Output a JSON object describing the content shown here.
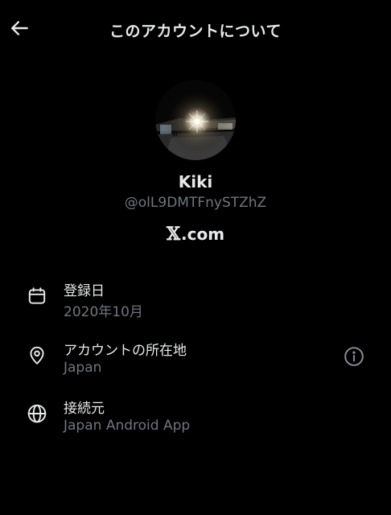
{
  "header": {
    "title": "このアカウントについて",
    "back_icon": "arrow-left-icon"
  },
  "profile": {
    "display_name": "Kiki",
    "handle": "@olL9DMTFnySTZhZ",
    "brand_symbol": "𝕏",
    "brand_text": ".com"
  },
  "rows": [
    {
      "icon": "calendar-icon",
      "label": "登録日",
      "value": "2020年10月"
    },
    {
      "icon": "location-pin-icon",
      "label": "アカウントの所在地",
      "value": "Japan",
      "action_icon": "info-icon"
    },
    {
      "icon": "globe-icon",
      "label": "接続元",
      "value": "Japan Android App"
    }
  ],
  "colors": {
    "background": "#000000",
    "primary_text": "#e7e9ea",
    "secondary_text": "#71767b",
    "icon_info": "#8b8f94"
  }
}
